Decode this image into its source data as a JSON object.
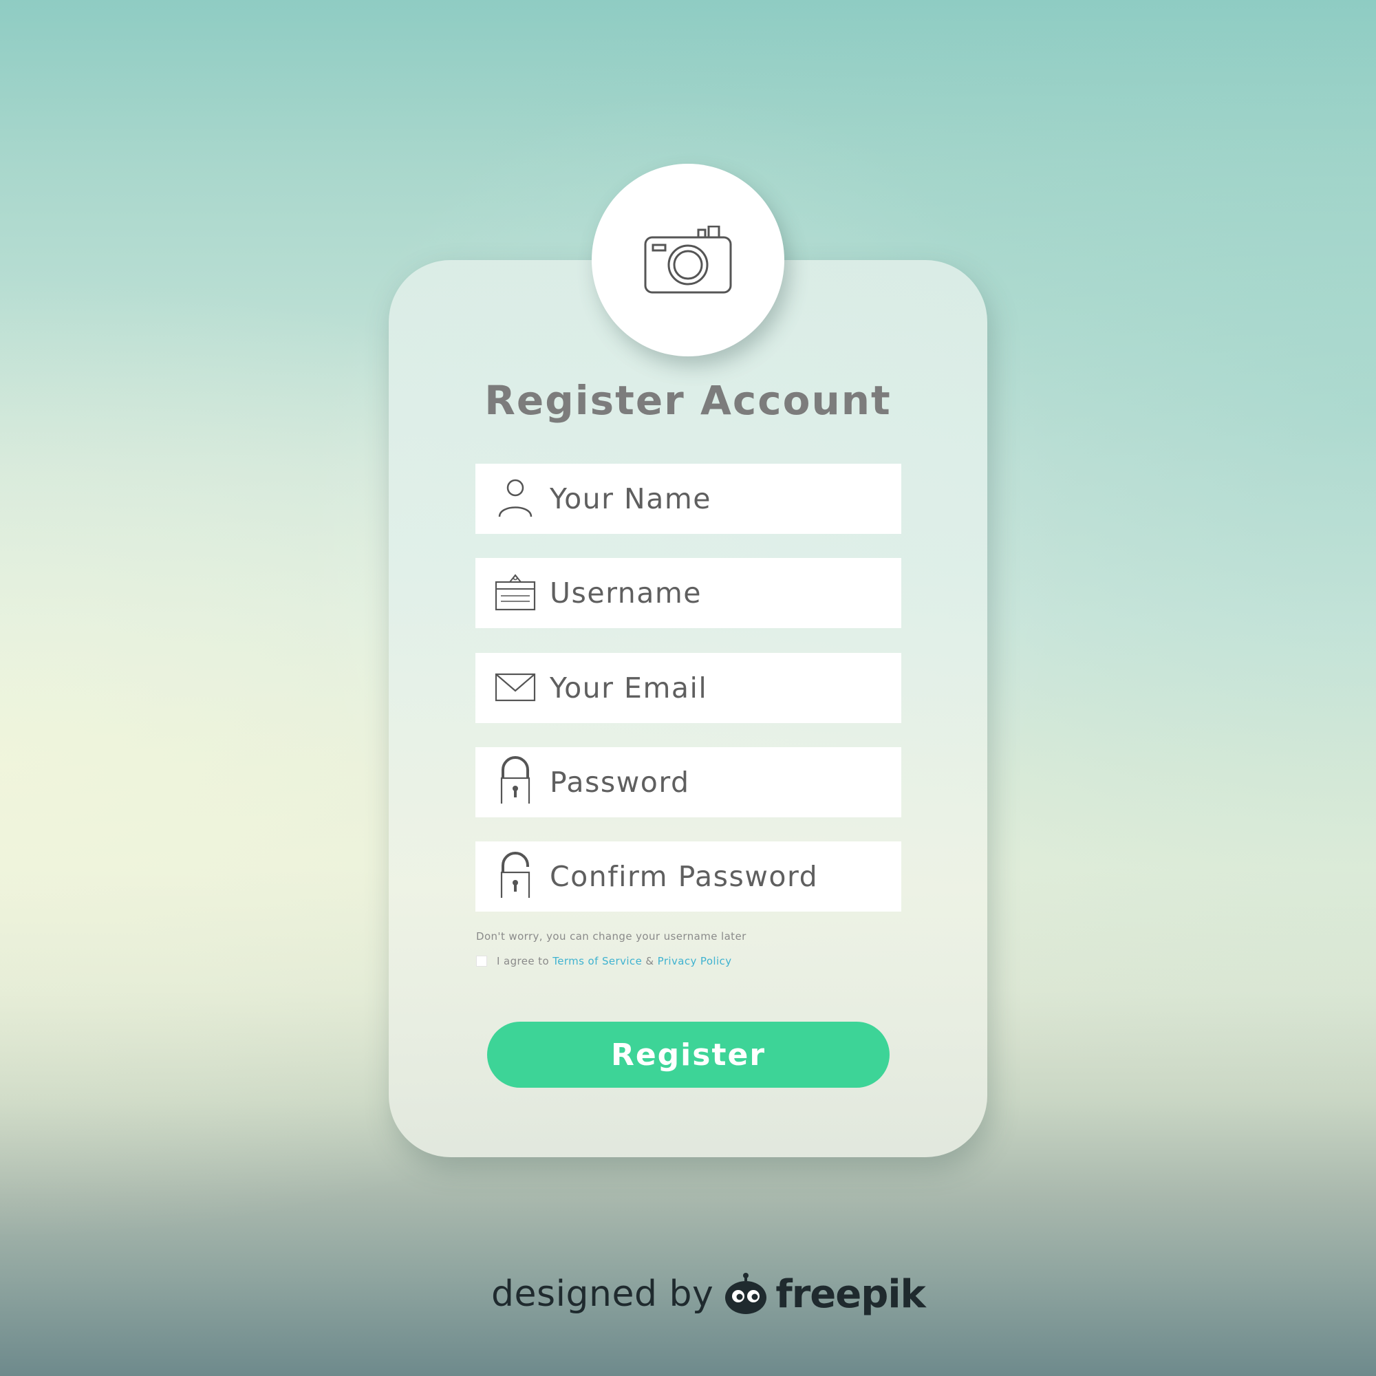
{
  "form": {
    "title": "Register Account",
    "fields": [
      {
        "name": "name",
        "placeholder": "Your Name",
        "icon": "user-icon"
      },
      {
        "name": "username",
        "placeholder": "Username",
        "icon": "id-card-icon"
      },
      {
        "name": "email",
        "placeholder": "Your Email",
        "icon": "envelope-icon"
      },
      {
        "name": "password",
        "placeholder": "Password",
        "icon": "lock-icon"
      },
      {
        "name": "confirm_password",
        "placeholder": "Confirm Password",
        "icon": "unlock-icon"
      }
    ],
    "hint": "Don't worry, you can change your username later",
    "agree": {
      "prefix": "I agree to ",
      "terms_link": "Terms of Service",
      "separator": " & ",
      "privacy_link": "Privacy Policy",
      "checked": false
    },
    "register_button": "Register",
    "avatar_icon": "camera-icon"
  },
  "credit": {
    "text": "designed by",
    "brand": "freepik",
    "logo_icon": "freepik-logo-icon"
  },
  "colors": {
    "accent": "#3dd497",
    "link": "#3fb2d0",
    "title": "#7c7c7c",
    "field_text": "#5f5f5f",
    "background_top": "#8fccc3",
    "background_bottom": "#6e8a8c"
  }
}
